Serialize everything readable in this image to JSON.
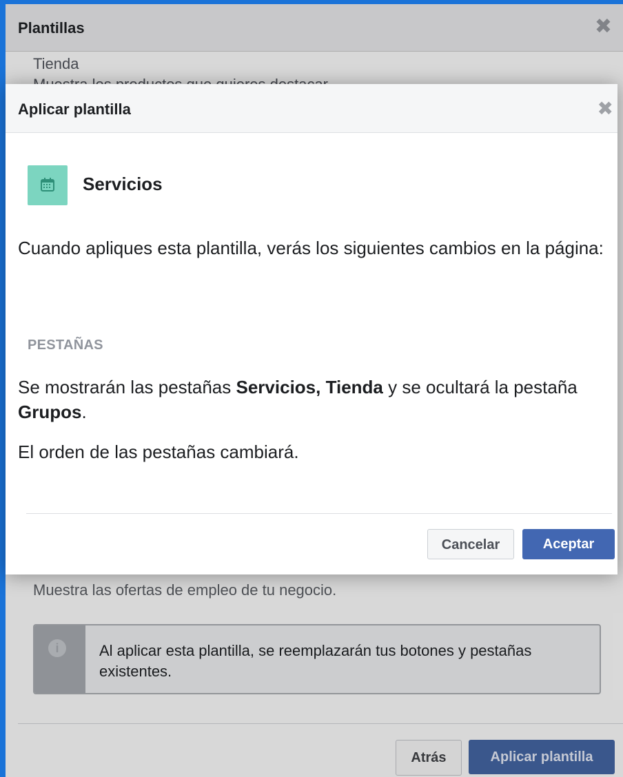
{
  "background_dialog": {
    "title": "Plantillas",
    "close_glyph": "✖",
    "tienda_title": "Tienda",
    "tienda_description": "Muestra los productos que quieres destacar",
    "jobs_description": "Muestra las ofertas de empleo de tu negocio.",
    "info_text": "Al aplicar esta plantilla, se reemplazarán tus botones y pestañas existentes.",
    "back_label": "Atrás",
    "apply_label": "Aplicar plantilla"
  },
  "modal": {
    "title": "Aplicar plantilla",
    "close_glyph": "✖",
    "template_name": "Servicios",
    "template_icon": "calendar-icon",
    "intro": "Cuando apliques esta plantilla, verás los siguientes cambios en la página:",
    "section_label": "PESTAÑAS",
    "change_text": {
      "part1": "Se mostrarán las pestañas ",
      "bold1": "Servicios, Tienda",
      "part2": " y se ocultará la pestaña ",
      "bold2": "Grupos",
      "part3": "."
    },
    "order_text": "El orden de las pestañas cambiará.",
    "cancel_label": "Cancelar",
    "accept_label": "Aceptar"
  },
  "colors": {
    "primary": "#4267b2",
    "template_icon_bg": "#7cd5c0",
    "frame_blue": "#1a73d8"
  }
}
